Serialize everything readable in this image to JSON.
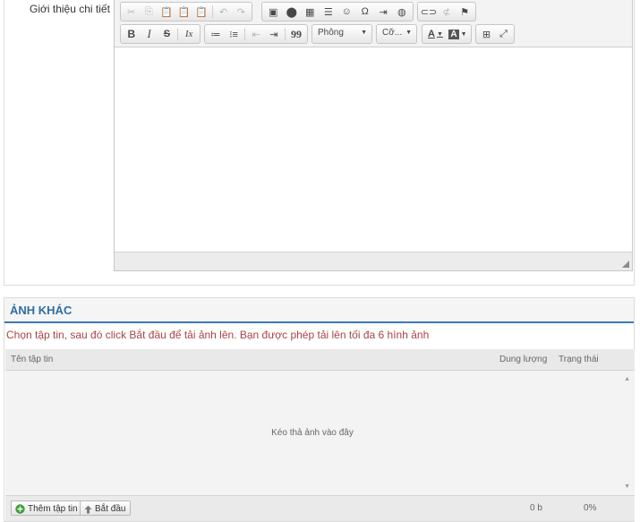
{
  "description": {
    "label": "Giới thiệu chi tiết",
    "toolbar": {
      "font_combo": "Phông",
      "size_combo": "Cỡ...",
      "bold_glyph": "B",
      "italic_glyph": "I",
      "strike_glyph": "S",
      "removeformat_glyph": "Ix",
      "text_color_glyph": "A",
      "bg_color_glyph": "A",
      "quote_glyph": "99",
      "omega_glyph": "Ω"
    }
  },
  "images_panel": {
    "title": "ẢNH KHÁC",
    "notice_prefix": "Chọn tập tin, sau đó click ",
    "notice_action": "Bắt đầu",
    "notice_middle": " để tải ảnh lên. Bạn được phép tải lên tối đa ",
    "notice_count": "6",
    "notice_suffix": " hình ảnh",
    "columns": {
      "name": "Tên tập tin",
      "size": "Dung lượng",
      "status": "Trạng thái"
    },
    "drop_text": "Kéo thả ảnh vào đây",
    "add_button": "Thêm tập tin",
    "start_button": "Bắt đầu",
    "total_size": "0 b",
    "total_percent": "0%"
  },
  "colors": {
    "title_blue": "#2e6da4",
    "notice_red": "#a94442",
    "add_green": "#3ea03a"
  }
}
